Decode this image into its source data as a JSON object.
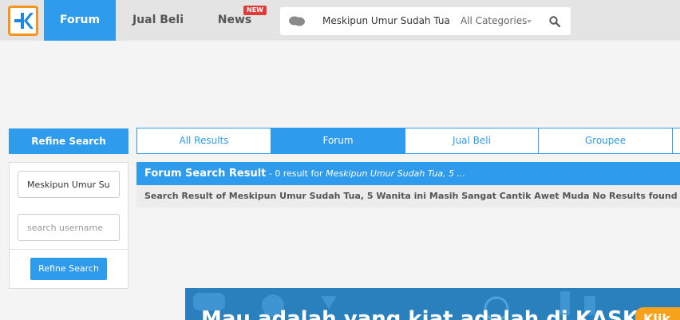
{
  "header": {
    "nav": [
      {
        "label": "Forum",
        "active": true
      },
      {
        "label": "Jual Beli",
        "active": false
      },
      {
        "label": "News",
        "active": false
      }
    ],
    "news_badge": "NEW",
    "search": {
      "value": "Meskipun Umur Sudah Tua",
      "category": "All Categories"
    }
  },
  "sidebar": {
    "title": "Refine Search",
    "keyword_value": "Meskipun Umur Sudah Tua",
    "username_placeholder": "search username",
    "button_label": "Refine Search"
  },
  "tabs": [
    {
      "label": "All Results",
      "active": false
    },
    {
      "label": "Forum",
      "active": true
    },
    {
      "label": "Jual Beli",
      "active": false
    },
    {
      "label": "Groupee",
      "active": false
    }
  ],
  "results": {
    "title": "Forum Search Result",
    "count_text": " - 0 result for ",
    "query_short": "Meskipun Umur Sudah Tua, 5 ...",
    "message": "Search Result of Meskipun Umur Sudah Tua, 5 Wanita ini Masih Sangat Cantik Awet Muda No Results found"
  },
  "banner": {
    "text": "Mau adalah yang kiat adalah di KASKUS ?",
    "cta": "Klik"
  },
  "colors": {
    "accent": "#2f9bec",
    "logo_orange": "#f7941d",
    "badge_red": "#e03b3b"
  }
}
